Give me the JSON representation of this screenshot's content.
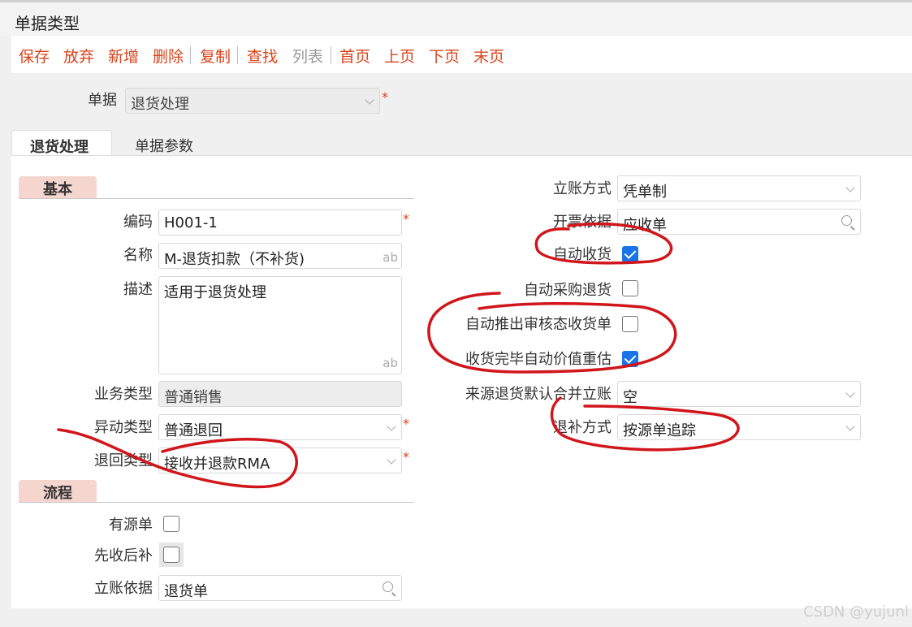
{
  "window": {
    "title": "单据类型"
  },
  "toolbar": {
    "save": "保存",
    "discard": "放弃",
    "add": "新增",
    "delete": "删除",
    "copy": "复制",
    "find": "查找",
    "list": "列表",
    "first": "首页",
    "prev": "上页",
    "next": "下页",
    "last": "末页"
  },
  "doc": {
    "label": "单据",
    "value": "退货处理",
    "required": "*"
  },
  "tabs": {
    "main": "退货处理",
    "params": "单据参数"
  },
  "basic": {
    "section": "基本",
    "code": {
      "label": "编码",
      "value": "H001-1"
    },
    "name": {
      "label": "名称",
      "value": "M-退货扣款（不补货)"
    },
    "desc": {
      "label": "描述",
      "value": "适用于退货处理"
    },
    "biz_type": {
      "label": "业务类型",
      "value": "普通销售"
    },
    "change_type": {
      "label": "异动类型",
      "value": "普通退回"
    },
    "return_type": {
      "label": "退回类型",
      "value": "接收并退款RMA"
    },
    "ab": "ab",
    "required": "*"
  },
  "flow": {
    "section": "流程",
    "has_source": {
      "label": "有源单",
      "checked": false
    },
    "receive_first": {
      "label": "先收后补",
      "checked": false
    },
    "account_basis": {
      "label": "立账依据",
      "value": "退货单"
    }
  },
  "right": {
    "account_method": {
      "label": "立账方式",
      "value": "凭单制"
    },
    "invoice_basis": {
      "label": "开票依据",
      "value": "应收单"
    },
    "auto_receive": {
      "label": "自动收货",
      "checked": true
    },
    "auto_purchase_return": {
      "label": "自动采购退货",
      "checked": false
    },
    "auto_push_receipt": {
      "label": "自动推出审核态收货单",
      "checked": false
    },
    "auto_revalue": {
      "label": "收货完毕自动价值重估",
      "checked": true
    },
    "source_merge": {
      "label": "来源退货默认合并立账",
      "value": "空"
    },
    "refund_method": {
      "label": "退补方式",
      "value": "按源单追踪"
    }
  },
  "watermark": "CSDN @yujunl",
  "colors": {
    "accent": "#d9441c",
    "check": "#1a73e8",
    "annotation": "#d0161b"
  }
}
